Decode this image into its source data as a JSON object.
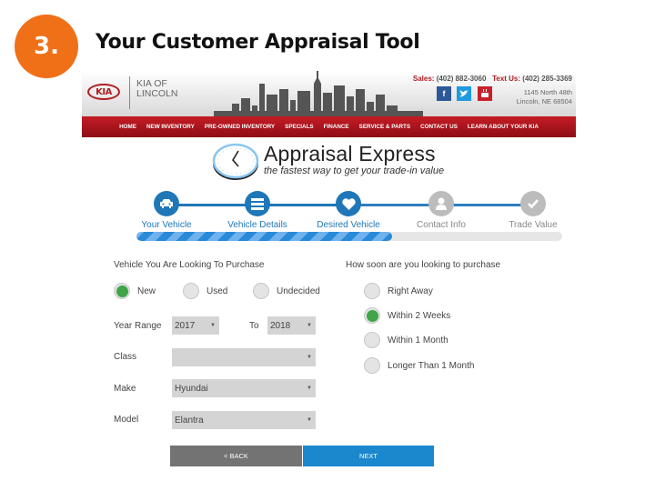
{
  "slide": {
    "step_number": "3.",
    "title": "Your Customer Appraisal Tool"
  },
  "dealer": {
    "logo_text": "KIA",
    "name_line1": "KIA OF",
    "name_line2": "LINCOLN",
    "sales_label": "Sales:",
    "sales_phone": "(402) 882-3060",
    "text_label": "Text Us:",
    "text_phone": "(402) 285-3369",
    "address_line1": "1145 North 48th",
    "address_line2": "Lincoln, NE 68504",
    "social": [
      "f",
      "t",
      "yt"
    ]
  },
  "nav": {
    "items": [
      "HOME",
      "NEW INVENTORY",
      "PRE-OWNED INVENTORY",
      "SPECIALS",
      "FINANCE",
      "SERVICE & PARTS",
      "CONTACT US",
      "LEARN ABOUT YOUR KIA"
    ]
  },
  "appraisal": {
    "title": "Appraisal Express",
    "tagline": "the fastest way to get your trade-in value"
  },
  "stepper": {
    "steps": [
      {
        "label": "Your Vehicle",
        "icon": "car-icon",
        "status": "done"
      },
      {
        "label": "Vehicle Details",
        "icon": "list-icon",
        "status": "done"
      },
      {
        "label": "Desired Vehicle",
        "icon": "heart-icon",
        "status": "done"
      },
      {
        "label": "Contact Info",
        "icon": "user-icon",
        "status": "todo"
      },
      {
        "label": "Trade Value",
        "icon": "check-icon",
        "status": "todo"
      }
    ],
    "progress_percent": 60
  },
  "form": {
    "purchase_heading": "Vehicle You Are Looking To Purchase",
    "condition_options": [
      {
        "label": "New",
        "selected": true
      },
      {
        "label": "Used",
        "selected": false
      },
      {
        "label": "Undecided",
        "selected": false
      }
    ],
    "year_range_label": "Year Range",
    "year_from": "2017",
    "to_label": "To",
    "year_to": "2018",
    "class_label": "Class",
    "class_value": "",
    "make_label": "Make",
    "make_value": "Hyundai",
    "model_label": "Model",
    "model_value": "Elantra",
    "timing_heading": "How soon are you looking to purchase",
    "timing_options": [
      {
        "label": "Right Away",
        "selected": false
      },
      {
        "label": "Within 2 Weeks",
        "selected": true
      },
      {
        "label": "Within 1 Month",
        "selected": false
      },
      {
        "label": "Longer Than 1 Month",
        "selected": false
      }
    ]
  },
  "buttons": {
    "back": "< BACK",
    "next": "NEXT"
  },
  "colors": {
    "badge": "#f07018",
    "kia_red": "#b01e23",
    "step_active": "#1f77b8",
    "radio_selected": "#3fa548",
    "next_button": "#1b87cc"
  }
}
